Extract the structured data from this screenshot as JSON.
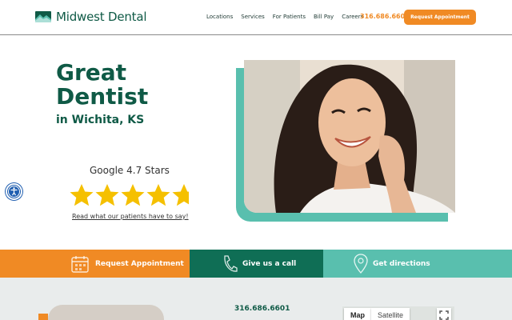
{
  "header": {
    "brand": "Midwest Dental",
    "nav": [
      "Locations",
      "Services",
      "For Patients",
      "Bill Pay",
      "Careers"
    ],
    "phone": "316.686.6601",
    "cta_label": "Request Appointment"
  },
  "hero": {
    "title_line1": "Great",
    "title_line2": "Dentist",
    "subtitle": "in Wichita, KS",
    "rating_label": "Google 4.7 Stars",
    "rating_value": 4.7,
    "rating_max": 5,
    "reviews_link": "Read what our patients have to say!"
  },
  "cta_bar": {
    "appointment": "Request Appointment",
    "call": "Give us a call",
    "directions": "Get directions"
  },
  "lower": {
    "phone": "316.686.6601",
    "map_tab": "Map",
    "satellite_tab": "Satellite"
  },
  "colors": {
    "brand_green": "#0f5a46",
    "accent_orange": "#f08a24",
    "teal": "#59bfae",
    "dark_teal": "#0f6e55",
    "star_yellow": "#f5c000"
  }
}
